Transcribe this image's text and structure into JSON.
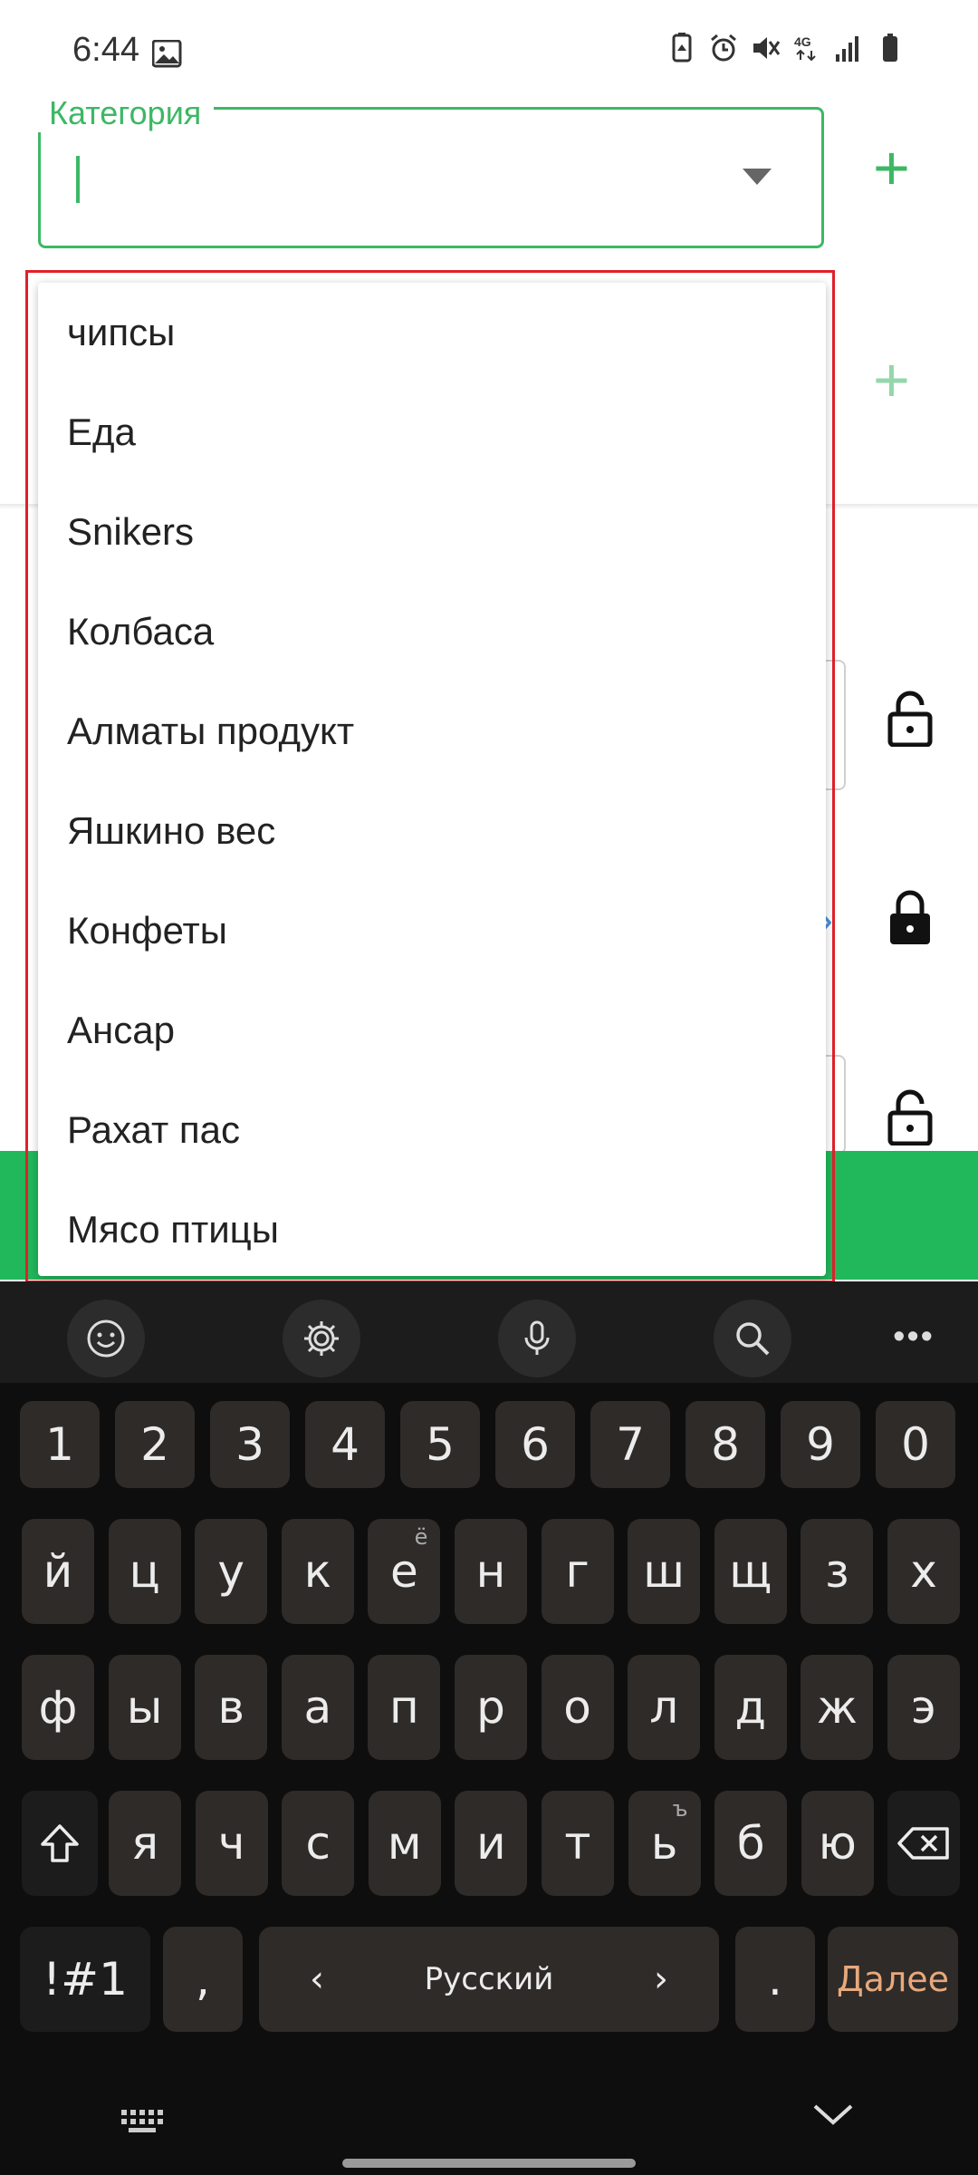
{
  "status_bar": {
    "time": "6:44",
    "icons": [
      "gallery-icon",
      "recycle-battery-icon",
      "alarm-icon",
      "mute-icon",
      "4g-icon",
      "signal-icon",
      "battery-icon"
    ]
  },
  "form": {
    "category_label": "Категория",
    "category_value": ""
  },
  "dropdown": {
    "items": [
      "чипсы",
      "Еда",
      "Snikers",
      "Колбаса",
      "Алматы продукт",
      "Яшкино вес",
      "Конфеты",
      "Ансар",
      "Рахат пас",
      "Мясо птицы"
    ]
  },
  "keyboard": {
    "toolbar": [
      "emoji-icon",
      "settings-icon",
      "microphone-icon",
      "search-icon",
      "more-icon"
    ],
    "row_numbers": [
      "1",
      "2",
      "3",
      "4",
      "5",
      "6",
      "7",
      "8",
      "9",
      "0"
    ],
    "row1": [
      "й",
      "ц",
      "у",
      "к",
      "е",
      "н",
      "г",
      "ш",
      "щ",
      "з",
      "х"
    ],
    "row1_sup": {
      "4": "ё"
    },
    "row2": [
      "ф",
      "ы",
      "в",
      "а",
      "п",
      "р",
      "о",
      "л",
      "д",
      "ж",
      "э"
    ],
    "row3": [
      "я",
      "ч",
      "с",
      "м",
      "и",
      "т",
      "ь",
      "б",
      "ю"
    ],
    "row3_sup": {
      "6": "ъ"
    },
    "symbols_label": "!#1",
    "comma_label": ",",
    "language_label": "Русский",
    "period_label": ".",
    "action_label": "Далее"
  },
  "colors": {
    "accent_green": "#3cb865",
    "action_green": "#21b75b",
    "highlight_red": "#e0202a",
    "keyboard_bg": "#0e0e0e",
    "key_bg": "#2e2b29",
    "done_text": "#e8a87c"
  }
}
